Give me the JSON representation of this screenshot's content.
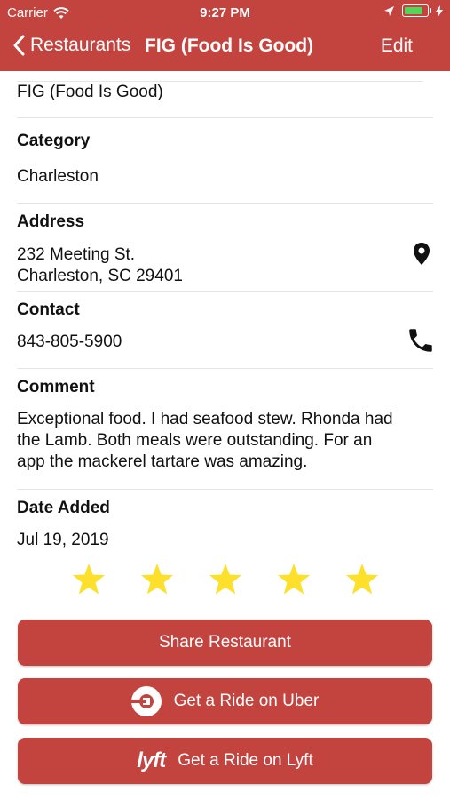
{
  "status_bar": {
    "carrier": "Carrier",
    "time": "9:27 PM"
  },
  "nav": {
    "back_label": "Restaurants",
    "title": "FIG (Food Is Good)",
    "edit_label": "Edit"
  },
  "restaurant": {
    "name": "FIG (Food Is Good)",
    "category_label": "Category",
    "category_value": "Charleston",
    "address_label": "Address",
    "address_line1": "232 Meeting St.",
    "address_line2": "Charleston, SC 29401",
    "contact_label": "Contact",
    "phone": "843-805-5900",
    "comment_label": "Comment",
    "comment_line1": "Exceptional food. I had seafood stew. Rhonda had",
    "comment_line2": "the Lamb. Both meals were outstanding. For an",
    "comment_line3": "app the mackerel tartare was amazing.",
    "date_label": "Date Added",
    "date_value": "Jul 19, 2019",
    "rating": 5
  },
  "buttons": {
    "share": "Share Restaurant",
    "uber": "Get a Ride on Uber",
    "lyft": "Get a Ride on Lyft",
    "lyft_logo": "lyft"
  },
  "colors": {
    "accent": "#c3433f",
    "star": "#fde02b"
  },
  "icons": {
    "location": "location-pin-icon",
    "phone": "phone-icon",
    "star": "star-icon"
  }
}
